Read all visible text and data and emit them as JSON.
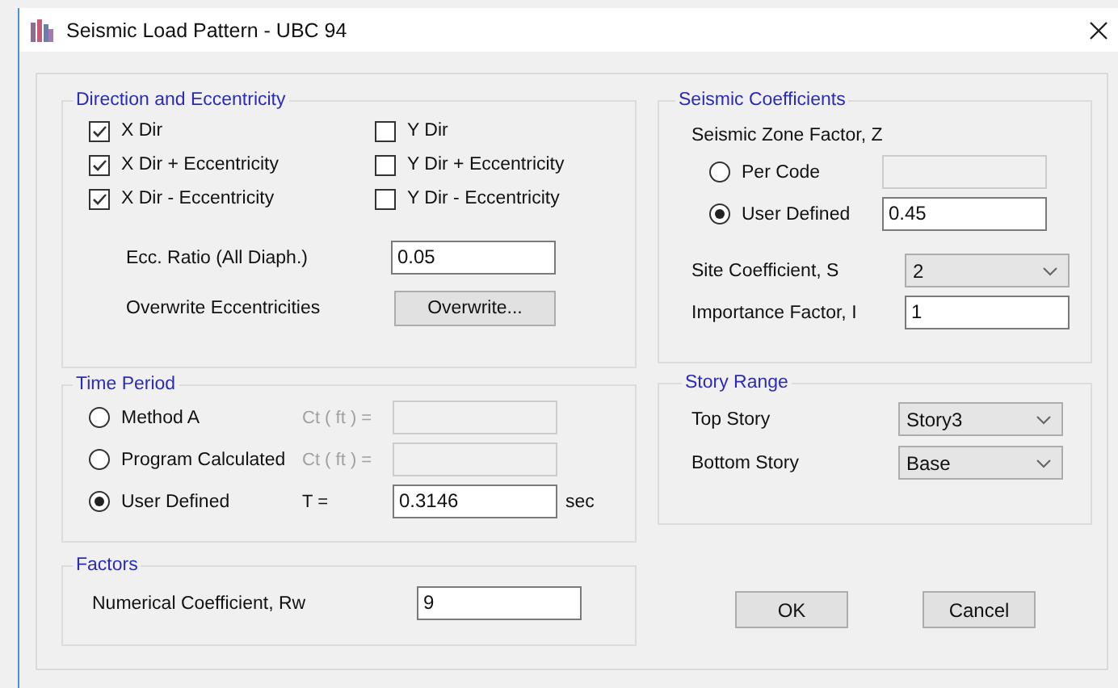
{
  "window": {
    "title": "Seismic Load Pattern - UBC 94"
  },
  "direction_group": {
    "title": "Direction and Eccentricity",
    "checkboxes": [
      {
        "label": "X Dir",
        "checked": true
      },
      {
        "label": "Y Dir",
        "checked": false
      },
      {
        "label": "X Dir + Eccentricity",
        "checked": true
      },
      {
        "label": "Y Dir + Eccentricity",
        "checked": false
      },
      {
        "label": "X Dir - Eccentricity",
        "checked": true
      },
      {
        "label": "Y Dir - Eccentricity",
        "checked": false
      }
    ],
    "ecc_ratio": {
      "label": "Ecc. Ratio (All Diaph.)",
      "value": "0.05"
    },
    "overwrite": {
      "label": "Overwrite Eccentricities",
      "button": "Overwrite..."
    }
  },
  "time_period_group": {
    "title": "Time Period",
    "options": [
      {
        "label": "Method A",
        "selected": false,
        "field_label": "Ct ( ft ) =",
        "disabled": true
      },
      {
        "label": "Program Calculated",
        "selected": false,
        "field_label": "Ct ( ft ) =",
        "disabled": true
      },
      {
        "label": "User Defined",
        "selected": true,
        "field_label": "T =",
        "disabled": false,
        "value": "0.3146",
        "unit": "sec"
      }
    ]
  },
  "factors_group": {
    "title": "Factors",
    "fields": [
      {
        "label": "Numerical Coefficient, Rw",
        "value": "9"
      }
    ]
  },
  "seismic_coefficients_group": {
    "title": "Seismic Coefficients",
    "zone_label": "Seismic Zone Factor, Z",
    "zone_options": [
      {
        "label": "Per Code",
        "selected": false,
        "disabled": true
      },
      {
        "label": "User Defined",
        "selected": true,
        "disabled": false,
        "value": "0.45"
      }
    ],
    "site_coefficient": {
      "label": "Site Coefficient, S",
      "value": "2"
    },
    "importance_factor": {
      "label": "Importance Factor, I",
      "value": "1"
    }
  },
  "story_range_group": {
    "title": "Story Range",
    "rows": [
      {
        "label": "Top Story",
        "value": "Story3"
      },
      {
        "label": "Bottom Story",
        "value": "Base"
      }
    ]
  },
  "buttons": [
    "OK",
    "Cancel"
  ]
}
